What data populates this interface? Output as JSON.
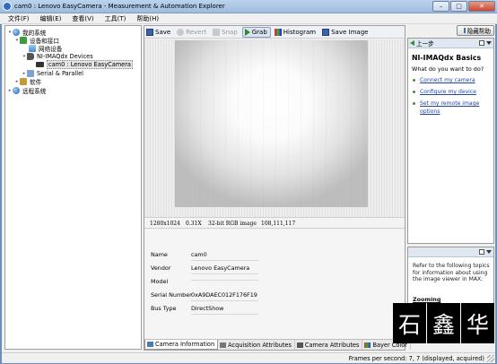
{
  "window": {
    "title": "cam0 : Lenovo EasyCamera - Measurement & Automation Explorer",
    "buttons": {
      "minimize": "–",
      "maximize": "□",
      "close": "✕"
    }
  },
  "menu": [
    "文件(F)",
    "编辑(E)",
    "查看(V)",
    "工具(T)",
    "帮助(H)"
  ],
  "tree": {
    "my_system": "我的系统",
    "devices_interfaces": "设备和接口",
    "network_devices": "网络设备",
    "imaqdx_devices": "NI-IMAQdx Devices",
    "camera": "cam0 : Lenovo EasyCamera",
    "serial_parallel": "Serial & Parallel",
    "software": "软件",
    "remote_systems": "远程系统"
  },
  "toolbar": {
    "save": "Save",
    "revert": "Revert",
    "snap": "Snap",
    "grab": "Grab",
    "histogram": "Histogram",
    "save_image": "Save Image"
  },
  "image_status": {
    "resolution": "1280x1024",
    "zoom": "0.31X",
    "format": "32-bit RGB image",
    "pixel_value": "108,111,117"
  },
  "camera_info": {
    "rows": [
      {
        "key": "Name",
        "value": "cam0"
      },
      {
        "key": "Vendor",
        "value": "Lenovo EasyCamera"
      },
      {
        "key": "Model",
        "value": ""
      },
      {
        "key": "Serial Number",
        "value": "0xA9DAEC012F176F19"
      },
      {
        "key": "Bus Type",
        "value": "DirectShow"
      }
    ]
  },
  "tabs": [
    "Camera Information",
    "Acquisition Attributes",
    "Camera Attributes",
    "Bayer Color"
  ],
  "help": {
    "hide_help": "隐藏帮助",
    "back": "上一步",
    "title": "NI-IMAQdx Basics",
    "question": "What do you want to do?",
    "links": [
      "Connect my camera",
      "Configure my device",
      "Set my remote image options"
    ],
    "lower_text": "Refer to the following topics for information about using the image viewer in MAX:",
    "lower_link": "Zooming"
  },
  "status": {
    "frames": "Frames per second: 7, 7 (displayed, acquired)"
  },
  "watermark": [
    "石",
    "鑫",
    "华"
  ]
}
